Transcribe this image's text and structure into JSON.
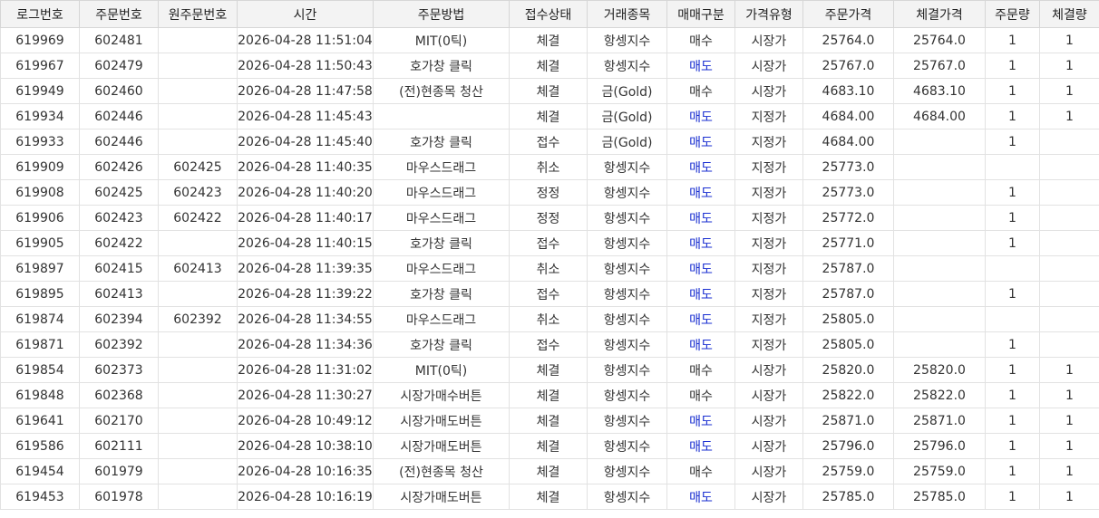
{
  "colors": {
    "sell_text": "#1a2fd1",
    "header_bg": "#f3f3f3",
    "text": "#333333"
  },
  "sell_value": "매도",
  "columns": [
    "로그번호",
    "주문번호",
    "원주문번호",
    "시간",
    "주문방법",
    "접수상태",
    "거래종목",
    "매매구분",
    "가격유형",
    "주문가격",
    "체결가격",
    "주문량",
    "체결량"
  ],
  "rows": [
    [
      "619969",
      "602481",
      "",
      "2026-04-28 11:51:04",
      "MIT(0틱)",
      "체결",
      "항셍지수",
      "매수",
      "시장가",
      "25764.0",
      "25764.0",
      "1",
      "1"
    ],
    [
      "619967",
      "602479",
      "",
      "2026-04-28 11:50:43",
      "호가창 클릭",
      "체결",
      "항셍지수",
      "매도",
      "시장가",
      "25767.0",
      "25767.0",
      "1",
      "1"
    ],
    [
      "619949",
      "602460",
      "",
      "2026-04-28 11:47:58",
      "(전)현종목 청산",
      "체결",
      "금(Gold)",
      "매수",
      "시장가",
      "4683.10",
      "4683.10",
      "1",
      "1"
    ],
    [
      "619934",
      "602446",
      "",
      "2026-04-28 11:45:43",
      "",
      "체결",
      "금(Gold)",
      "매도",
      "지정가",
      "4684.00",
      "4684.00",
      "1",
      "1"
    ],
    [
      "619933",
      "602446",
      "",
      "2026-04-28 11:45:40",
      "호가창 클릭",
      "접수",
      "금(Gold)",
      "매도",
      "지정가",
      "4684.00",
      "",
      "1",
      ""
    ],
    [
      "619909",
      "602426",
      "602425",
      "2026-04-28 11:40:35",
      "마우스드래그",
      "취소",
      "항셍지수",
      "매도",
      "지정가",
      "25773.0",
      "",
      "",
      ""
    ],
    [
      "619908",
      "602425",
      "602423",
      "2026-04-28 11:40:20",
      "마우스드래그",
      "정정",
      "항셍지수",
      "매도",
      "지정가",
      "25773.0",
      "",
      "1",
      ""
    ],
    [
      "619906",
      "602423",
      "602422",
      "2026-04-28 11:40:17",
      "마우스드래그",
      "정정",
      "항셍지수",
      "매도",
      "지정가",
      "25772.0",
      "",
      "1",
      ""
    ],
    [
      "619905",
      "602422",
      "",
      "2026-04-28 11:40:15",
      "호가창 클릭",
      "접수",
      "항셍지수",
      "매도",
      "지정가",
      "25771.0",
      "",
      "1",
      ""
    ],
    [
      "619897",
      "602415",
      "602413",
      "2026-04-28 11:39:35",
      "마우스드래그",
      "취소",
      "항셍지수",
      "매도",
      "지정가",
      "25787.0",
      "",
      "",
      ""
    ],
    [
      "619895",
      "602413",
      "",
      "2026-04-28 11:39:22",
      "호가창 클릭",
      "접수",
      "항셍지수",
      "매도",
      "지정가",
      "25787.0",
      "",
      "1",
      ""
    ],
    [
      "619874",
      "602394",
      "602392",
      "2026-04-28 11:34:55",
      "마우스드래그",
      "취소",
      "항셍지수",
      "매도",
      "지정가",
      "25805.0",
      "",
      "",
      ""
    ],
    [
      "619871",
      "602392",
      "",
      "2026-04-28 11:34:36",
      "호가창 클릭",
      "접수",
      "항셍지수",
      "매도",
      "지정가",
      "25805.0",
      "",
      "1",
      ""
    ],
    [
      "619854",
      "602373",
      "",
      "2026-04-28 11:31:02",
      "MIT(0틱)",
      "체결",
      "항셍지수",
      "매수",
      "시장가",
      "25820.0",
      "25820.0",
      "1",
      "1"
    ],
    [
      "619848",
      "602368",
      "",
      "2026-04-28 11:30:27",
      "시장가매수버튼",
      "체결",
      "항셍지수",
      "매수",
      "시장가",
      "25822.0",
      "25822.0",
      "1",
      "1"
    ],
    [
      "619641",
      "602170",
      "",
      "2026-04-28 10:49:12",
      "시장가매도버튼",
      "체결",
      "항셍지수",
      "매도",
      "시장가",
      "25871.0",
      "25871.0",
      "1",
      "1"
    ],
    [
      "619586",
      "602111",
      "",
      "2026-04-28 10:38:10",
      "시장가매도버튼",
      "체결",
      "항셍지수",
      "매도",
      "시장가",
      "25796.0",
      "25796.0",
      "1",
      "1"
    ],
    [
      "619454",
      "601979",
      "",
      "2026-04-28 10:16:35",
      "(전)현종목 청산",
      "체결",
      "항셍지수",
      "매수",
      "시장가",
      "25759.0",
      "25759.0",
      "1",
      "1"
    ],
    [
      "619453",
      "601978",
      "",
      "2026-04-28 10:16:19",
      "시장가매도버튼",
      "체결",
      "항셍지수",
      "매도",
      "시장가",
      "25785.0",
      "25785.0",
      "1",
      "1"
    ]
  ]
}
